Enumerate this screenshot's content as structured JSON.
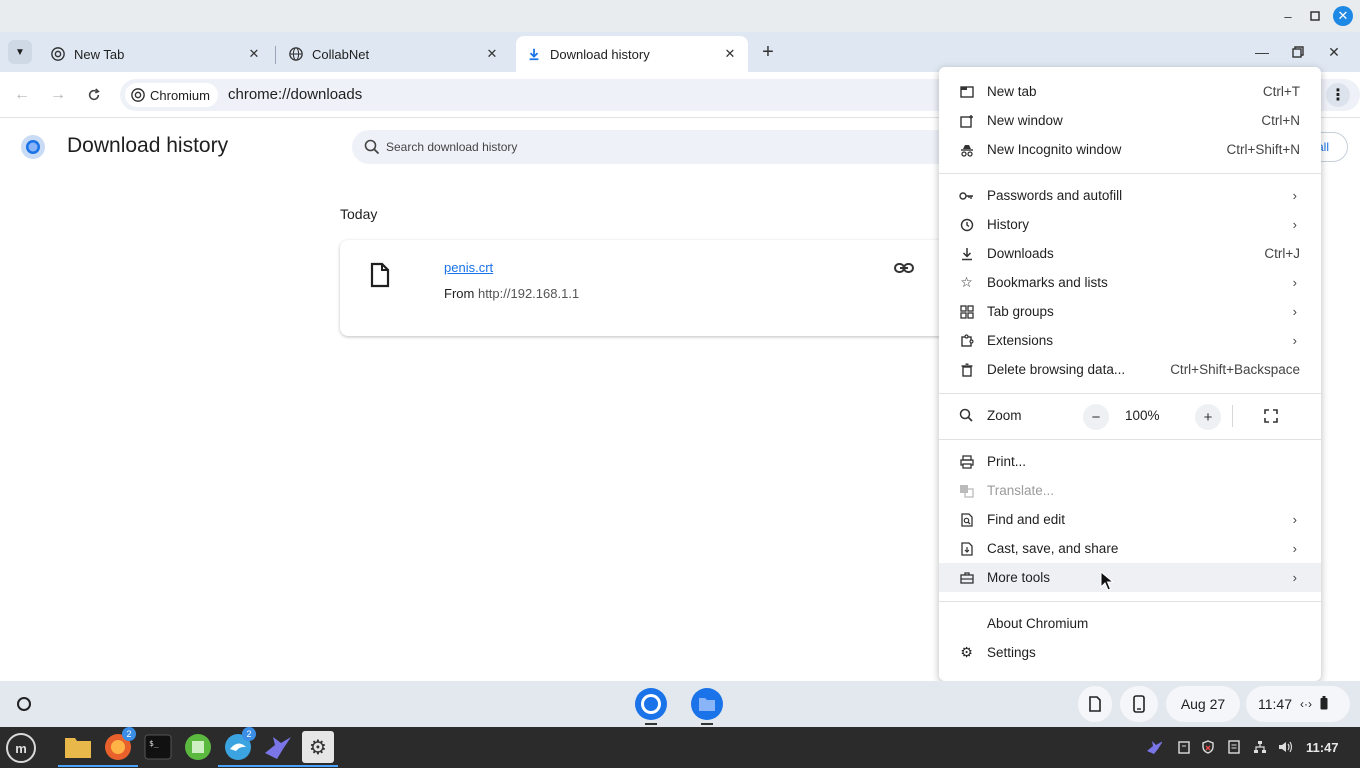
{
  "browser": {
    "tabs": [
      {
        "title": "New Tab"
      },
      {
        "title": "CollabNet"
      },
      {
        "title": "Download history"
      }
    ],
    "omnibox": {
      "chip": "Chromium",
      "url": "chrome://downloads"
    }
  },
  "page": {
    "title": "Download history",
    "search_placeholder": "Search download history",
    "clear_all": "all",
    "section": "Today",
    "download": {
      "filename": "penis.crt",
      "from_label": "From",
      "source": "http://192.168.1.1"
    }
  },
  "menu": {
    "items": [
      {
        "label": "New tab",
        "shortcut": "Ctrl+T"
      },
      {
        "label": "New window",
        "shortcut": "Ctrl+N"
      },
      {
        "label": "New Incognito window",
        "shortcut": "Ctrl+Shift+N"
      },
      {
        "label": "Passwords and autofill"
      },
      {
        "label": "History"
      },
      {
        "label": "Downloads",
        "shortcut": "Ctrl+J"
      },
      {
        "label": "Bookmarks and lists"
      },
      {
        "label": "Tab groups"
      },
      {
        "label": "Extensions"
      },
      {
        "label": "Delete browsing data...",
        "shortcut": "Ctrl+Shift+Backspace"
      },
      {
        "label": "Print..."
      },
      {
        "label": "Translate..."
      },
      {
        "label": "Find and edit"
      },
      {
        "label": "Cast, save, and share"
      },
      {
        "label": "More tools"
      },
      {
        "label": "About Chromium"
      },
      {
        "label": "Settings"
      }
    ],
    "zoom": {
      "label": "Zoom",
      "value": "100%",
      "minus": "−",
      "plus": "+"
    },
    "arrow": "›"
  },
  "shelf": {
    "date": "Aug 27",
    "time": "11:47"
  },
  "taskbar": {
    "time": "11:47",
    "badge_firefox": "2",
    "badge_dolphin": "2",
    "start_glyph": "m"
  },
  "colors": {
    "accent": "#1a73e8",
    "tabstrip": "#dfe7f2",
    "omnibox": "#eef2f8",
    "taskbar": "#2b2b2b"
  }
}
